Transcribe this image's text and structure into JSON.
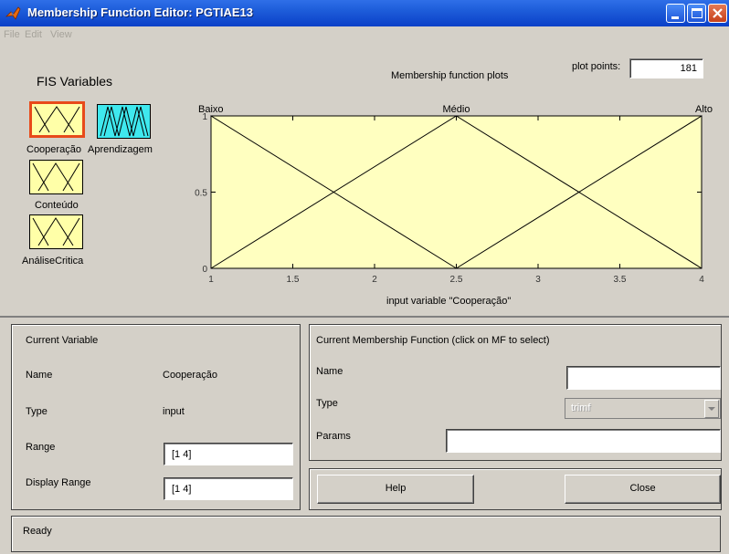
{
  "window": {
    "title": "Membership Function Editor: PGTIAE13"
  },
  "menu": {
    "items": [
      "File",
      "Edit",
      "View"
    ]
  },
  "fis": {
    "title": "FIS Variables",
    "variables": [
      {
        "label": "Cooperação",
        "kind": "input",
        "selected": true
      },
      {
        "label": "Aprendizagem",
        "kind": "output",
        "selected": false
      },
      {
        "label": "Conteúdo",
        "kind": "input",
        "selected": false
      },
      {
        "label": "AnáliseCritica",
        "kind": "input",
        "selected": false
      }
    ]
  },
  "plot": {
    "title": "Membership function plots",
    "plot_points_label": "plot points:",
    "plot_points_value": "181",
    "xlabel": "input variable \"Cooperação\""
  },
  "chart_data": {
    "type": "line",
    "title": "Membership function plots",
    "xlabel": "input variable \"Cooperação\"",
    "ylabel": "",
    "xlim": [
      1,
      4
    ],
    "ylim": [
      0,
      1
    ],
    "x_ticks": [
      "1",
      "1.5",
      "2",
      "2.5",
      "3",
      "3.5",
      "4"
    ],
    "y_ticks": [
      "0",
      "0.5",
      "1"
    ],
    "background": "#ffffc0",
    "series": [
      {
        "name": "Baixo",
        "x": [
          1,
          1,
          2.5
        ],
        "y": [
          0,
          1,
          0
        ]
      },
      {
        "name": "Médio",
        "x": [
          1,
          2.5,
          4
        ],
        "y": [
          0,
          1,
          0
        ]
      },
      {
        "name": "Alto",
        "x": [
          2.5,
          4,
          4
        ],
        "y": [
          0,
          1,
          0
        ]
      }
    ]
  },
  "current_variable": {
    "header": "Current Variable",
    "name_label": "Name",
    "name_value": "Cooperação",
    "type_label": "Type",
    "type_value": "input",
    "range_label": "Range",
    "range_value": "[1 4]",
    "display_range_label": "Display Range",
    "display_range_value": "[1 4]"
  },
  "current_mf": {
    "header": "Current Membership Function (click on MF to select)",
    "name_label": "Name",
    "name_value": "",
    "type_label": "Type",
    "type_value": "trimf",
    "params_label": "Params",
    "params_value": ""
  },
  "buttons": {
    "help": "Help",
    "close": "Close"
  },
  "status": {
    "text": "Ready"
  },
  "colors": {
    "titlebar": "#0a3fc8",
    "panel": "#d4d0c8",
    "mf_input": "#ffffa8",
    "mf_output": "#3fe8ee",
    "selected_border": "#e84a1a"
  }
}
